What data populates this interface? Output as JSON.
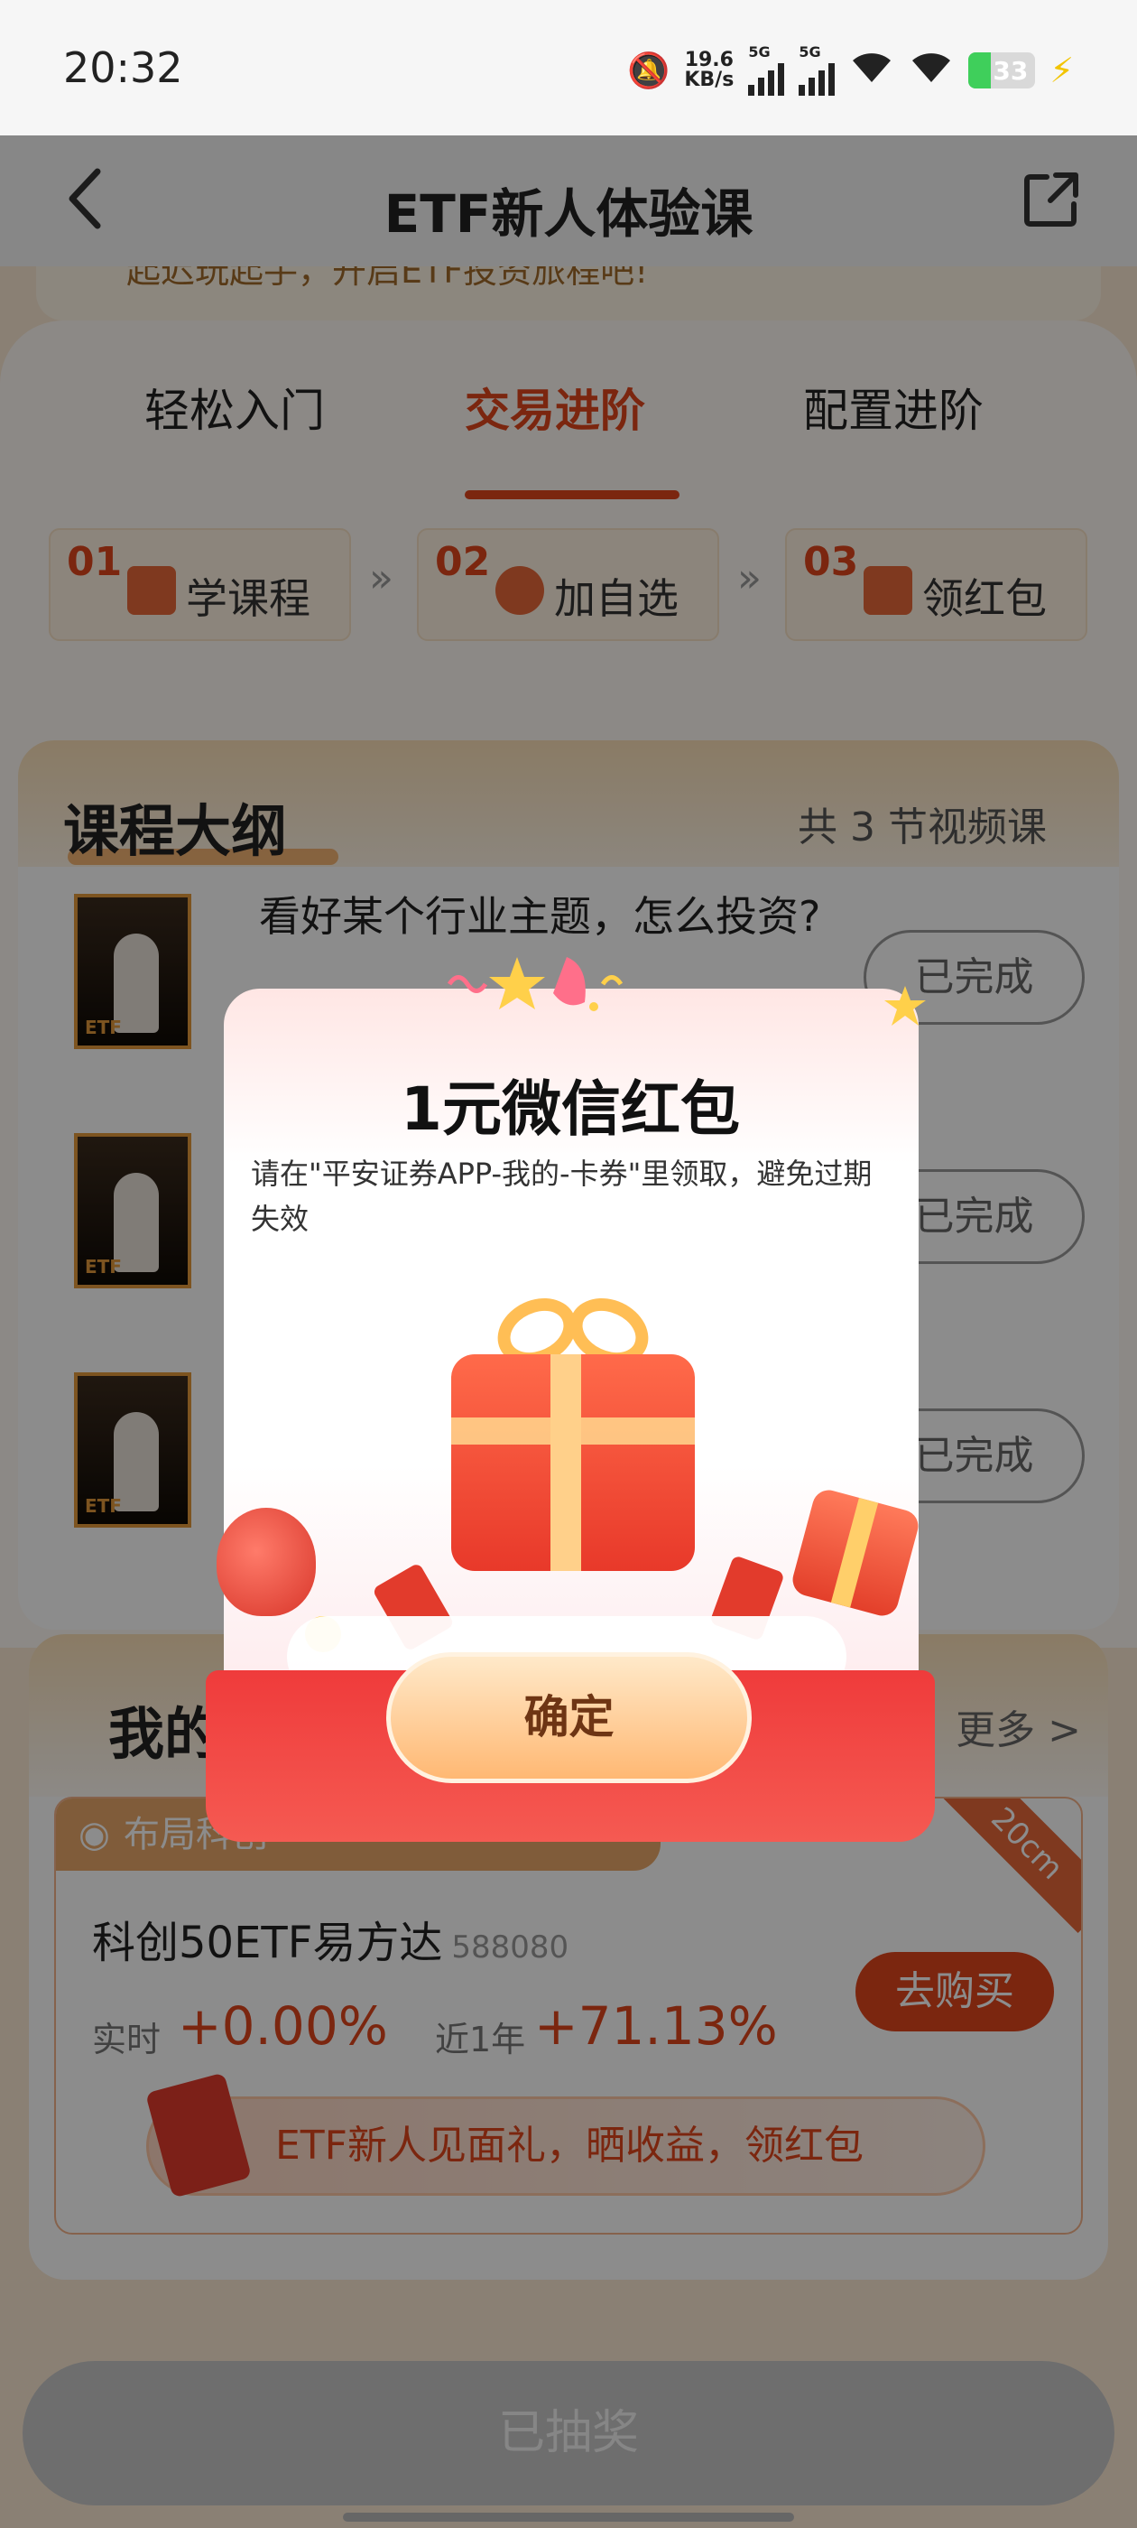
{
  "status_bar": {
    "time": "20:32",
    "net_speed_value": "19.6",
    "net_speed_unit": "KB/s",
    "signal1_label": "5G",
    "signal2_label": "5G",
    "battery": "33",
    "battery_level": 0.33,
    "icons": [
      "bell-off-icon",
      "signal-icon",
      "signal-icon",
      "wifi-icon",
      "wifi-icon",
      "battery-icon",
      "charging-icon"
    ]
  },
  "nav": {
    "title": "ETF新人体验课",
    "back_icon": "chevron-left-icon",
    "share_icon": "share-icon"
  },
  "top_banner_text": "起迟玩起手，开启ETF投资旅程吧!",
  "tabs": [
    {
      "label": "轻松入门",
      "active": false
    },
    {
      "label": "交易进阶",
      "active": true
    },
    {
      "label": "配置进阶",
      "active": false
    }
  ],
  "steps": [
    {
      "num": "01",
      "label": "学课程",
      "icon": "book-icon"
    },
    {
      "num": "02",
      "label": "加自选",
      "icon": "tap-icon"
    },
    {
      "num": "03",
      "label": "领红包",
      "icon": "gift-icon"
    }
  ],
  "step_separator": "»",
  "outline": {
    "title": "课程大纲",
    "count": "共 3 节视频课",
    "lessons": [
      {
        "title": "看好某个行业主题，怎么投资?",
        "status": "已完成",
        "thumb_tag": "ETF"
      },
      {
        "title": "",
        "status": "已完成",
        "thumb_tag": "ETF"
      },
      {
        "title": "",
        "status": "已完成",
        "thumb_tag": "ETF"
      }
    ]
  },
  "fund_section": {
    "title": "我的",
    "more": "更多 >",
    "theme": "布局科创",
    "corner_tag": "20cm",
    "name": "科创50ETF易方达",
    "code": "588080",
    "realtime_label": "实时",
    "realtime_value": "+0.00%",
    "year_label": "近1年",
    "year_value": "+71.13%",
    "buy_label": "去购买",
    "gift_banner": "ETF新人见面礼，晒收益，领红包"
  },
  "draw_button": "已抽奖",
  "modal": {
    "title": "1元微信红包",
    "description": "请在\"平安证券APP-我的-卡券\"里领取，避免过期失效",
    "confirm": "确定"
  },
  "colors": {
    "accent": "#e0451d",
    "modal_base": "#ef3b3b",
    "confirm_bg": "#ffb873"
  }
}
